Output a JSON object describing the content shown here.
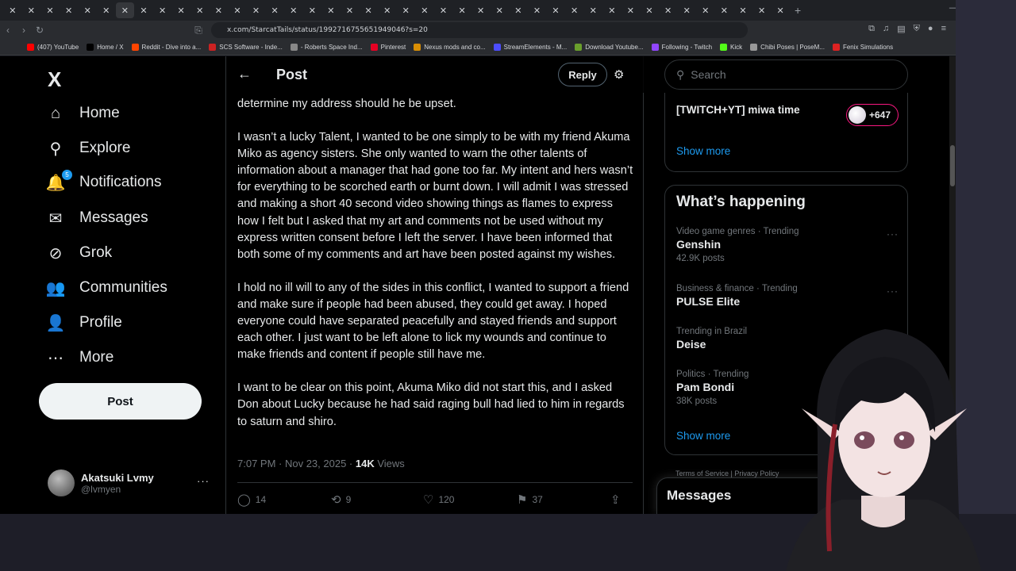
{
  "browser": {
    "tab_glyph": "✕",
    "plus": "+",
    "url": "x.com/StarcatTails/status/1992716755651949046?s=20",
    "bookmarks": [
      "(407) YouTube",
      "Home / X",
      "Reddit - Dive into a...",
      "SCS Software - Inde...",
      "- Roberts Space Ind...",
      "Pinterest",
      "Nexus mods and co...",
      "StreamElements - M...",
      "Download Youtube...",
      "Following - Twitch",
      "Kick",
      "Chibi Poses | PoseM...",
      "Fenix Simulations"
    ],
    "bookmark_colors": [
      "#ff0000",
      "#000000",
      "#ff4500",
      "#c22",
      "#888",
      "#e60023",
      "#d98e04",
      "#4d4dff",
      "#6a9f2c",
      "#9146ff",
      "#53fc18",
      "#999",
      "#d22"
    ]
  },
  "nav": {
    "logo": "X",
    "items": [
      {
        "label": "Home",
        "icon": "⌂"
      },
      {
        "label": "Explore",
        "icon": "⚲"
      },
      {
        "label": "Notifications",
        "icon": "🔔",
        "badge": "5"
      },
      {
        "label": "Messages",
        "icon": "✉"
      },
      {
        "label": "Grok",
        "icon": "⊘"
      },
      {
        "label": "Communities",
        "icon": "👥"
      },
      {
        "label": "Profile",
        "icon": "👤"
      },
      {
        "label": "More",
        "icon": "⋯"
      }
    ],
    "post_label": "Post",
    "account": {
      "name": "Akatsuki Lvmy",
      "handle": "@lvmyen",
      "more": "···"
    }
  },
  "post": {
    "header_title": "Post",
    "reply_label": "Reply",
    "paragraphs": [
      "determine my address should he be upset.",
      "I wasn’t a lucky Talent, I wanted to be one simply to be with my friend Akuma Miko as agency sisters. She only wanted to warn the other talents of information about a manager that had gone too far. My intent and hers wasn’t for everything to be scorched earth or burnt down. I will admit I was stressed and making a short 40 second video showing things as flames to express how I felt but I asked that my art and comments not be used without my express written consent before I left the server. I have been informed that both some of my comments and art have been posted against my wishes.",
      "I hold no ill will to any of the sides in this conflict, I wanted to support a friend and make sure if people had been abused, they could get away. I hoped everyone could have separated peacefully and stayed friends and support each other. I just want to be left alone to lick my wounds and continue to make friends and content if people still have me.",
      "I want to be clear on this point, Akuma Miko did not start this, and I asked Don about Lucky because he had said raging bull had lied to him in regards to saturn and shiro."
    ],
    "timestamp": "7:07 PM · Nov 23, 2025 · ",
    "views_count": "14K",
    "views_label": " Views",
    "stats": {
      "replies": "14",
      "reposts": "9",
      "likes": "120",
      "bookmarks": "37"
    }
  },
  "sidebar": {
    "search_placeholder": "Search",
    "live": {
      "title": "[TWITCH+YT] miwa time",
      "count": "+647",
      "show_more": "Show more"
    },
    "trends_title": "What’s happening",
    "trends": [
      {
        "context": "Video game genres · Trending",
        "name": "Genshin",
        "count": "42.9K posts"
      },
      {
        "context": "Business & finance · Trending",
        "name": "PULSE Elite",
        "count": ""
      },
      {
        "context": "Trending in Brazil",
        "name": "Deise",
        "count": ""
      },
      {
        "context": "Politics · Trending",
        "name": "Pam Bondi",
        "count": "38K posts"
      }
    ],
    "show_more": "Show more",
    "footer": "Terms of Service  |  Privacy Policy",
    "messages_title": "Messages"
  }
}
